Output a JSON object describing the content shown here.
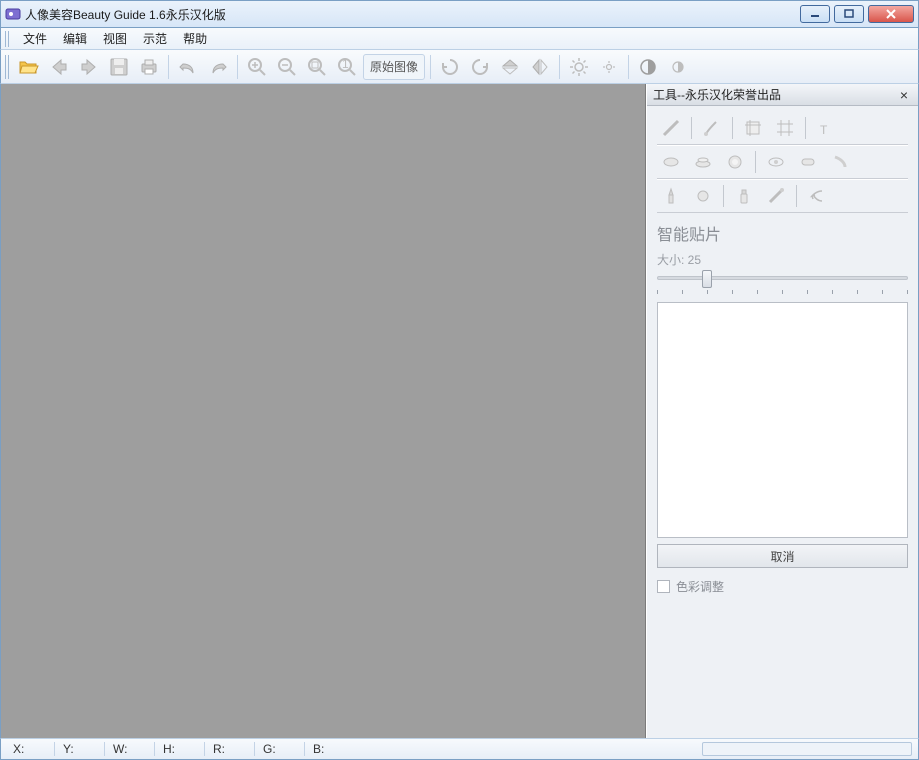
{
  "window": {
    "title": "人像美容Beauty Guide 1.6永乐汉化版"
  },
  "menu": {
    "file": "文件",
    "edit": "编辑",
    "view": "视图",
    "demo": "示范",
    "help": "帮助"
  },
  "toolbar": {
    "original_image": "原始图像"
  },
  "tool_panel": {
    "title": "工具--永乐汉化荣誉出品",
    "section_title": "智能贴片",
    "size_label": "大小: 25",
    "size_value": 25,
    "cancel": "取消",
    "color_adjust": "色彩调整"
  },
  "status": {
    "x": "X:",
    "y": "Y:",
    "w": "W:",
    "h": "H:",
    "r": "R:",
    "g": "G:",
    "b": "B:"
  }
}
